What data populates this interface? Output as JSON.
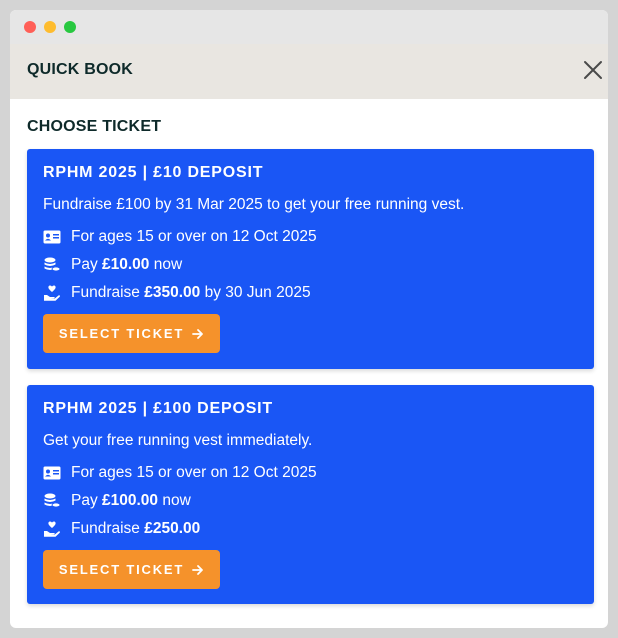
{
  "modal": {
    "title": "QUICK BOOK",
    "close_icon": "close-icon"
  },
  "section_title": "CHOOSE TICKET",
  "tickets": [
    {
      "title": "RPHM 2025 | £10 DEPOSIT",
      "description": "Fundraise £100 by 31 Mar 2025 to get your free running vest.",
      "age": "For ages 15 or over on 12 Oct 2025",
      "pay_prefix": "Pay ",
      "pay_amount": "£10.00",
      "pay_suffix": " now",
      "fundraise_prefix": "Fundraise ",
      "fundraise_amount": "£350.00",
      "fundraise_suffix": " by 30 Jun 2025",
      "button_label": "SELECT TICKET"
    },
    {
      "title": "RPHM 2025 | £100 DEPOSIT",
      "description": "Get your free running vest immediately.",
      "age": "For ages 15 or over on 12 Oct 2025",
      "pay_prefix": "Pay ",
      "pay_amount": "£100.00",
      "pay_suffix": " now",
      "fundraise_prefix": "Fundraise ",
      "fundraise_amount": "£250.00",
      "fundraise_suffix": "",
      "button_label": "SELECT TICKET"
    }
  ],
  "icons": {
    "age": "id-card-icon",
    "pay": "coins-icon",
    "fundraise": "hand-heart-icon",
    "button": "arrow-right-icon"
  },
  "colors": {
    "card": "#1a56f5",
    "button": "#f5922b",
    "header": "#e9e6e1",
    "title_text": "#0e2a2a"
  }
}
